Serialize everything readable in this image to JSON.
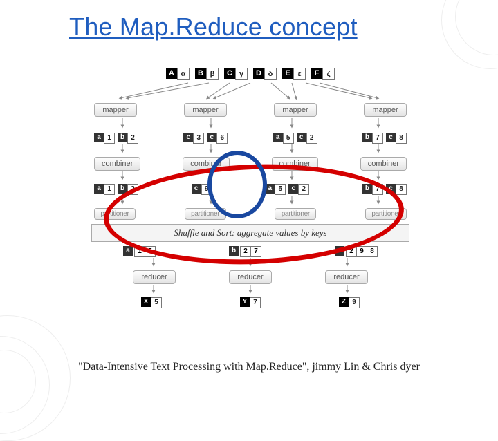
{
  "title": "The Map.Reduce concept",
  "input_pairs": [
    {
      "k": "A",
      "v": "α"
    },
    {
      "k": "B",
      "v": "β"
    },
    {
      "k": "C",
      "v": "γ"
    },
    {
      "k": "D",
      "v": "δ"
    },
    {
      "k": "E",
      "v": "ε"
    },
    {
      "k": "F",
      "v": "ζ"
    }
  ],
  "mapper_label": "mapper",
  "after_map": [
    [
      {
        "k": "a",
        "v": "1"
      },
      {
        "k": "b",
        "v": "2"
      }
    ],
    [
      {
        "k": "c",
        "v": "3"
      },
      {
        "k": "c",
        "v": "6"
      }
    ],
    [
      {
        "k": "a",
        "v": "5"
      },
      {
        "k": "c",
        "v": "2"
      }
    ],
    [
      {
        "k": "b",
        "v": "7"
      },
      {
        "k": "c",
        "v": "8"
      }
    ]
  ],
  "combiner_label": "combiner",
  "after_combine": [
    [
      {
        "k": "a",
        "v": "1"
      },
      {
        "k": "b",
        "v": "2"
      }
    ],
    [
      {
        "k": "c",
        "v": "9"
      }
    ],
    [
      {
        "k": "a",
        "v": "5"
      },
      {
        "k": "c",
        "v": "2"
      }
    ],
    [
      {
        "k": "b",
        "v": "7"
      },
      {
        "k": "c",
        "v": "8"
      }
    ]
  ],
  "partitioner_label": "partitioner",
  "shuffle_label": "Shuffle and Sort: aggregate values by keys",
  "shuffle_out": [
    {
      "k": "a",
      "vs": [
        "1",
        "5"
      ]
    },
    {
      "k": "b",
      "vs": [
        "2",
        "7"
      ]
    },
    {
      "k": "c",
      "vs": [
        "2",
        "9",
        "8"
      ]
    }
  ],
  "reducer_label": "reducer",
  "final": [
    {
      "k": "X",
      "v": "5"
    },
    {
      "k": "Y",
      "v": "7"
    },
    {
      "k": "Z",
      "v": "9"
    }
  ],
  "caption": "\"Data-Intensive Text Processing with Map.Reduce\", jimmy Lin & Chris dyer"
}
